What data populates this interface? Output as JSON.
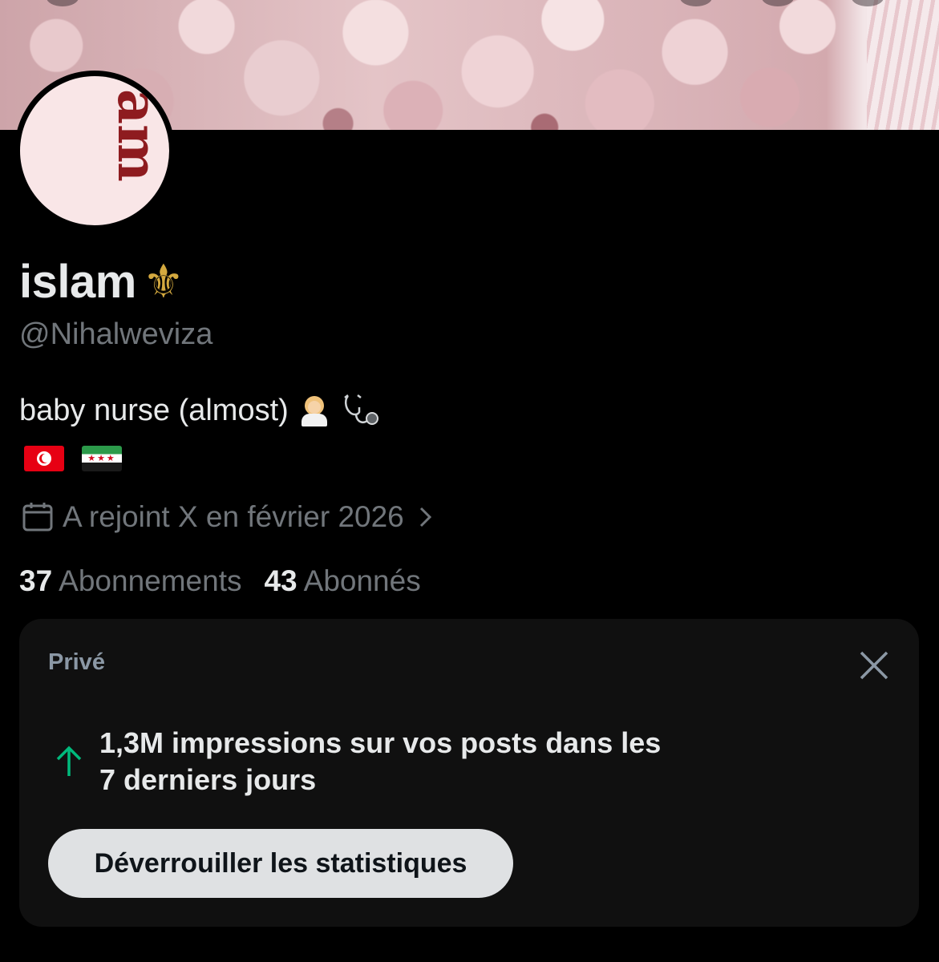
{
  "profile": {
    "display_name": "islam",
    "name_decoration": "⚜",
    "handle": "@Nihalweviza",
    "bio": "baby nurse (almost)",
    "bio_emojis": [
      "woman-health-worker-icon",
      "stethoscope-icon"
    ],
    "flags": [
      "tunisia-flag",
      "syria-independence-flag"
    ],
    "joined": "A rejoint X en février 2026",
    "following_count": "37",
    "following_label": "Abonnements",
    "followers_count": "43",
    "followers_label": "Abonnés"
  },
  "stats_card": {
    "tag": "Privé",
    "message_line1": "1,3M impressions sur vos posts dans les",
    "message_line2": "7 derniers jours",
    "button_label": "Déverrouiller les statistiques"
  },
  "colors": {
    "background": "#000000",
    "primary_text": "#e7e9ea",
    "secondary_text": "#71767b",
    "card_bg": "#101010",
    "trend_up": "#00ba7c",
    "button_bg": "#dfe1e3"
  }
}
